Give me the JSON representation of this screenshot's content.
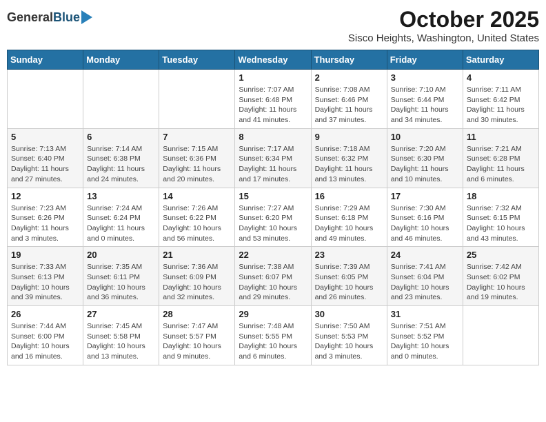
{
  "header": {
    "logo_general": "General",
    "logo_blue": "Blue",
    "month_title": "October 2025",
    "location": "Sisco Heights, Washington, United States"
  },
  "days_of_week": [
    "Sunday",
    "Monday",
    "Tuesday",
    "Wednesday",
    "Thursday",
    "Friday",
    "Saturday"
  ],
  "weeks": [
    [
      {
        "day": "",
        "sunrise": "",
        "sunset": "",
        "daylight": ""
      },
      {
        "day": "",
        "sunrise": "",
        "sunset": "",
        "daylight": ""
      },
      {
        "day": "",
        "sunrise": "",
        "sunset": "",
        "daylight": ""
      },
      {
        "day": "1",
        "sunrise": "Sunrise: 7:07 AM",
        "sunset": "Sunset: 6:48 PM",
        "daylight": "Daylight: 11 hours and 41 minutes."
      },
      {
        "day": "2",
        "sunrise": "Sunrise: 7:08 AM",
        "sunset": "Sunset: 6:46 PM",
        "daylight": "Daylight: 11 hours and 37 minutes."
      },
      {
        "day": "3",
        "sunrise": "Sunrise: 7:10 AM",
        "sunset": "Sunset: 6:44 PM",
        "daylight": "Daylight: 11 hours and 34 minutes."
      },
      {
        "day": "4",
        "sunrise": "Sunrise: 7:11 AM",
        "sunset": "Sunset: 6:42 PM",
        "daylight": "Daylight: 11 hours and 30 minutes."
      }
    ],
    [
      {
        "day": "5",
        "sunrise": "Sunrise: 7:13 AM",
        "sunset": "Sunset: 6:40 PM",
        "daylight": "Daylight: 11 hours and 27 minutes."
      },
      {
        "day": "6",
        "sunrise": "Sunrise: 7:14 AM",
        "sunset": "Sunset: 6:38 PM",
        "daylight": "Daylight: 11 hours and 24 minutes."
      },
      {
        "day": "7",
        "sunrise": "Sunrise: 7:15 AM",
        "sunset": "Sunset: 6:36 PM",
        "daylight": "Daylight: 11 hours and 20 minutes."
      },
      {
        "day": "8",
        "sunrise": "Sunrise: 7:17 AM",
        "sunset": "Sunset: 6:34 PM",
        "daylight": "Daylight: 11 hours and 17 minutes."
      },
      {
        "day": "9",
        "sunrise": "Sunrise: 7:18 AM",
        "sunset": "Sunset: 6:32 PM",
        "daylight": "Daylight: 11 hours and 13 minutes."
      },
      {
        "day": "10",
        "sunrise": "Sunrise: 7:20 AM",
        "sunset": "Sunset: 6:30 PM",
        "daylight": "Daylight: 11 hours and 10 minutes."
      },
      {
        "day": "11",
        "sunrise": "Sunrise: 7:21 AM",
        "sunset": "Sunset: 6:28 PM",
        "daylight": "Daylight: 11 hours and 6 minutes."
      }
    ],
    [
      {
        "day": "12",
        "sunrise": "Sunrise: 7:23 AM",
        "sunset": "Sunset: 6:26 PM",
        "daylight": "Daylight: 11 hours and 3 minutes."
      },
      {
        "day": "13",
        "sunrise": "Sunrise: 7:24 AM",
        "sunset": "Sunset: 6:24 PM",
        "daylight": "Daylight: 11 hours and 0 minutes."
      },
      {
        "day": "14",
        "sunrise": "Sunrise: 7:26 AM",
        "sunset": "Sunset: 6:22 PM",
        "daylight": "Daylight: 10 hours and 56 minutes."
      },
      {
        "day": "15",
        "sunrise": "Sunrise: 7:27 AM",
        "sunset": "Sunset: 6:20 PM",
        "daylight": "Daylight: 10 hours and 53 minutes."
      },
      {
        "day": "16",
        "sunrise": "Sunrise: 7:29 AM",
        "sunset": "Sunset: 6:18 PM",
        "daylight": "Daylight: 10 hours and 49 minutes."
      },
      {
        "day": "17",
        "sunrise": "Sunrise: 7:30 AM",
        "sunset": "Sunset: 6:16 PM",
        "daylight": "Daylight: 10 hours and 46 minutes."
      },
      {
        "day": "18",
        "sunrise": "Sunrise: 7:32 AM",
        "sunset": "Sunset: 6:15 PM",
        "daylight": "Daylight: 10 hours and 43 minutes."
      }
    ],
    [
      {
        "day": "19",
        "sunrise": "Sunrise: 7:33 AM",
        "sunset": "Sunset: 6:13 PM",
        "daylight": "Daylight: 10 hours and 39 minutes."
      },
      {
        "day": "20",
        "sunrise": "Sunrise: 7:35 AM",
        "sunset": "Sunset: 6:11 PM",
        "daylight": "Daylight: 10 hours and 36 minutes."
      },
      {
        "day": "21",
        "sunrise": "Sunrise: 7:36 AM",
        "sunset": "Sunset: 6:09 PM",
        "daylight": "Daylight: 10 hours and 32 minutes."
      },
      {
        "day": "22",
        "sunrise": "Sunrise: 7:38 AM",
        "sunset": "Sunset: 6:07 PM",
        "daylight": "Daylight: 10 hours and 29 minutes."
      },
      {
        "day": "23",
        "sunrise": "Sunrise: 7:39 AM",
        "sunset": "Sunset: 6:05 PM",
        "daylight": "Daylight: 10 hours and 26 minutes."
      },
      {
        "day": "24",
        "sunrise": "Sunrise: 7:41 AM",
        "sunset": "Sunset: 6:04 PM",
        "daylight": "Daylight: 10 hours and 23 minutes."
      },
      {
        "day": "25",
        "sunrise": "Sunrise: 7:42 AM",
        "sunset": "Sunset: 6:02 PM",
        "daylight": "Daylight: 10 hours and 19 minutes."
      }
    ],
    [
      {
        "day": "26",
        "sunrise": "Sunrise: 7:44 AM",
        "sunset": "Sunset: 6:00 PM",
        "daylight": "Daylight: 10 hours and 16 minutes."
      },
      {
        "day": "27",
        "sunrise": "Sunrise: 7:45 AM",
        "sunset": "Sunset: 5:58 PM",
        "daylight": "Daylight: 10 hours and 13 minutes."
      },
      {
        "day": "28",
        "sunrise": "Sunrise: 7:47 AM",
        "sunset": "Sunset: 5:57 PM",
        "daylight": "Daylight: 10 hours and 9 minutes."
      },
      {
        "day": "29",
        "sunrise": "Sunrise: 7:48 AM",
        "sunset": "Sunset: 5:55 PM",
        "daylight": "Daylight: 10 hours and 6 minutes."
      },
      {
        "day": "30",
        "sunrise": "Sunrise: 7:50 AM",
        "sunset": "Sunset: 5:53 PM",
        "daylight": "Daylight: 10 hours and 3 minutes."
      },
      {
        "day": "31",
        "sunrise": "Sunrise: 7:51 AM",
        "sunset": "Sunset: 5:52 PM",
        "daylight": "Daylight: 10 hours and 0 minutes."
      },
      {
        "day": "",
        "sunrise": "",
        "sunset": "",
        "daylight": ""
      }
    ]
  ]
}
